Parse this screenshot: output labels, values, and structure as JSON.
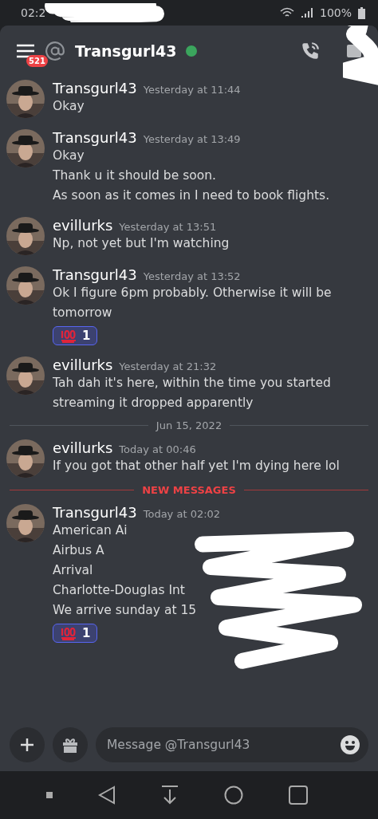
{
  "status_bar": {
    "time": "02:2",
    "battery": "100%"
  },
  "header": {
    "badge": "521",
    "title": "Transgurl43",
    "online": true
  },
  "feed": [
    {
      "kind": "message",
      "author": "Transgurl43",
      "timestamp": "Yesterday at 11:44",
      "lines": [
        "Okay"
      ]
    },
    {
      "kind": "message",
      "author": "Transgurl43",
      "timestamp": "Yesterday at 13:49",
      "lines": [
        "Okay",
        "Thank u it should be soon.",
        "As soon as it comes in I need to book flights."
      ]
    },
    {
      "kind": "message",
      "author": "evillurks",
      "timestamp": "Yesterday at 13:51",
      "lines": [
        "Np, not yet but I'm watching"
      ]
    },
    {
      "kind": "message",
      "author": "Transgurl43",
      "timestamp": "Yesterday at 13:52",
      "lines": [
        "Ok I figure 6pm probably. Otherwise it will be tomorrow"
      ],
      "reaction": {
        "count": "1",
        "selected": true
      }
    },
    {
      "kind": "message",
      "author": "evillurks",
      "timestamp": "Yesterday at 21:32",
      "lines": [
        "Tah dah it's here, within the time you started streaming it dropped apparently"
      ]
    },
    {
      "kind": "date",
      "label": "Jun 15, 2022"
    },
    {
      "kind": "message",
      "author": "evillurks",
      "timestamp": "Today at 00:46",
      "lines": [
        "If you got that other half yet I'm dying here lol"
      ]
    },
    {
      "kind": "new",
      "label": "NEW MESSAGES"
    },
    {
      "kind": "message",
      "author": "Transgurl43",
      "timestamp": "Today at 02:02",
      "lines": [
        "American Ai",
        "Airbus A",
        "Arrival",
        "Charlotte-Douglas Int",
        "We arrive sunday at 15"
      ],
      "redacted": true,
      "reaction": {
        "count": "1",
        "selected": true
      }
    }
  ],
  "composer": {
    "placeholder": "Message @Transgurl43"
  }
}
